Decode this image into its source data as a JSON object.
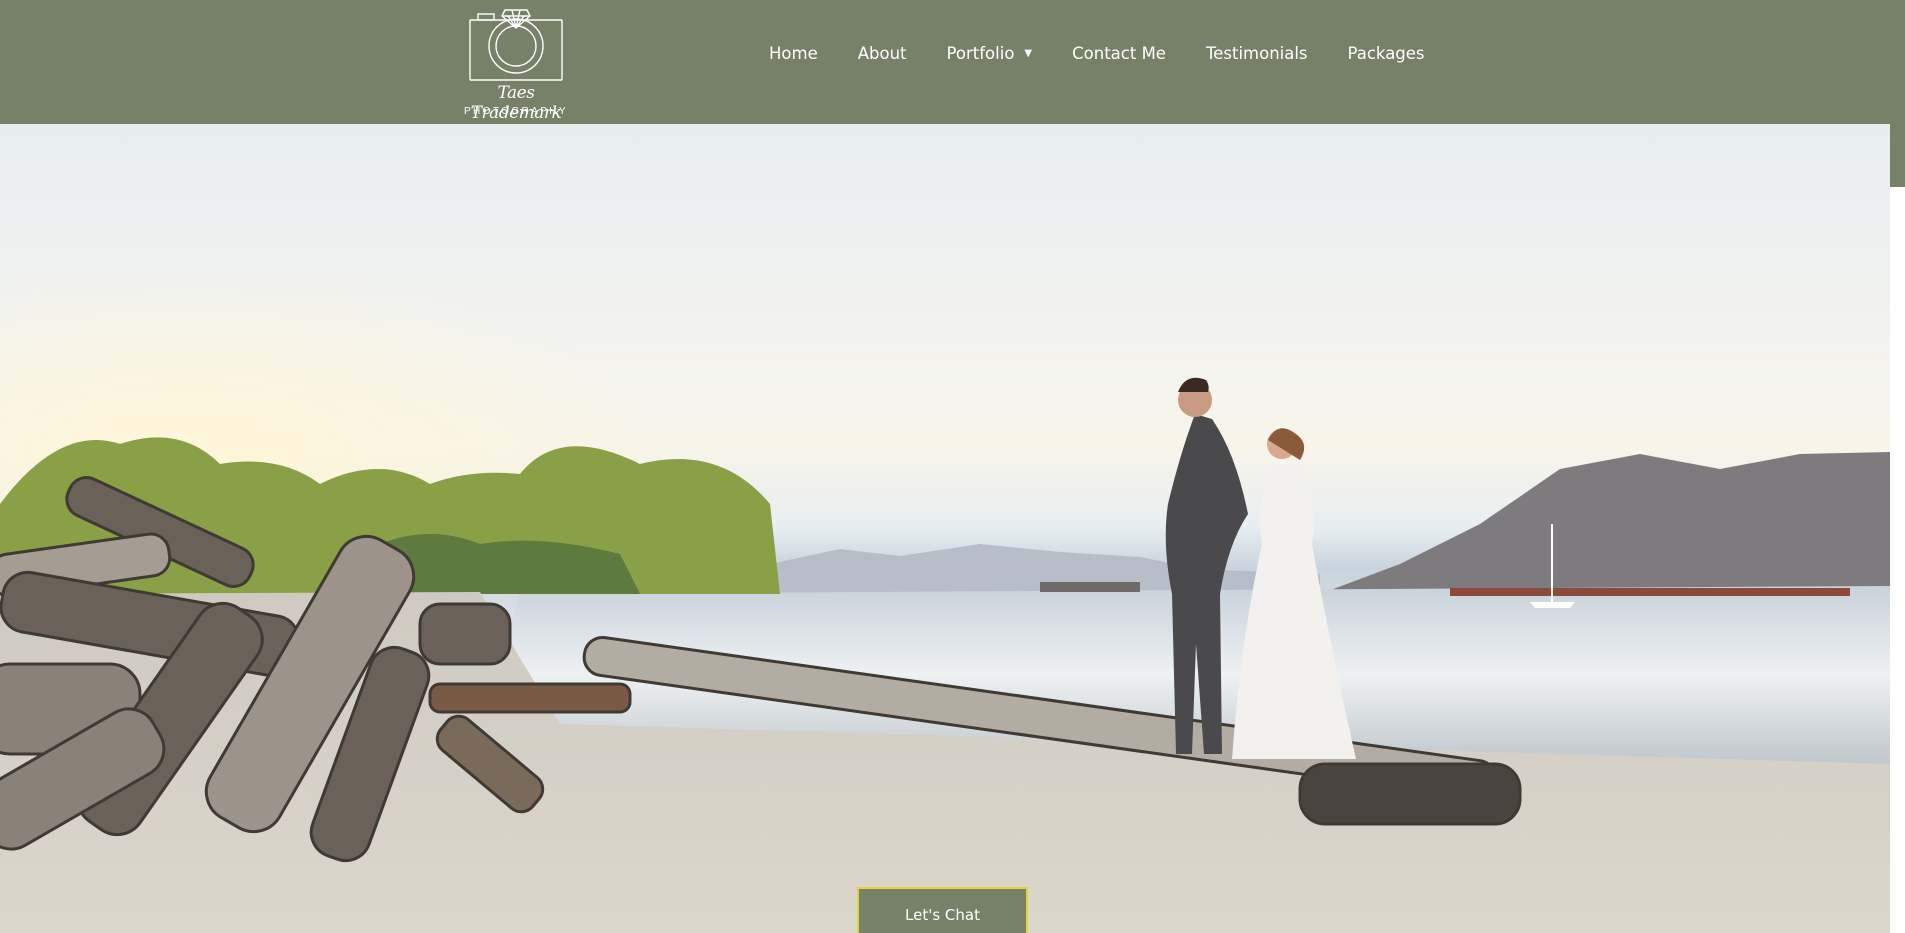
{
  "brand": {
    "logo_text": "Taes Trademark",
    "logo_subtext": "PHOTOGRAPHY",
    "color_header": "#778168",
    "color_button_border": "#e3d431"
  },
  "nav": {
    "items": [
      {
        "label": "Home"
      },
      {
        "label": "About"
      },
      {
        "label": "Portfolio",
        "has_dropdown": true,
        "caret": "▼"
      },
      {
        "label": "Contact Me"
      },
      {
        "label": "Testimonials"
      },
      {
        "label": "Packages"
      }
    ]
  },
  "hero": {
    "image_icon": "wedding-couple-beach-photo",
    "cta_label": "Let's Chat"
  }
}
